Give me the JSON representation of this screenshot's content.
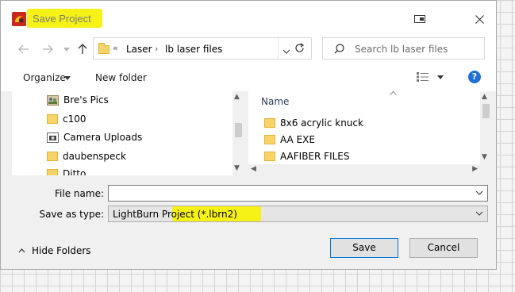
{
  "window": {
    "title": "Save Project",
    "highlight_color": "#f6f218"
  },
  "nav": {
    "back_icon": "arrow-left-icon",
    "forward_icon": "arrow-right-icon",
    "up_icon": "arrow-up-icon",
    "overflow": "«",
    "crumbs": [
      "Laser",
      "lb laser files"
    ],
    "search_placeholder": "Search lb laser files"
  },
  "toolbar": {
    "organize_label": "Organize",
    "new_folder_label": "New folder",
    "help_label": "?"
  },
  "tree": {
    "items": [
      {
        "label": "Bre's Pics",
        "icon": "pictures-icon"
      },
      {
        "label": "c100",
        "icon": "folder-icon"
      },
      {
        "label": "Camera Uploads",
        "icon": "camera-icon"
      },
      {
        "label": "daubenspeck",
        "icon": "folder-icon"
      },
      {
        "label": "Ditto",
        "icon": "folder-icon"
      }
    ]
  },
  "files": {
    "column_name": "Name",
    "items": [
      {
        "label": "8x6 acrylic knuck"
      },
      {
        "label": "AA EXE"
      },
      {
        "label": "AAFIBER FILES"
      }
    ]
  },
  "form": {
    "file_name_label": "File name:",
    "file_name_value": "",
    "save_as_type_label": "Save as type:",
    "save_as_type_value": "LightBurn Project (*.lbrn2)"
  },
  "footer": {
    "hide_folders_label": "Hide Folders",
    "save_label": "Save",
    "cancel_label": "Cancel"
  }
}
